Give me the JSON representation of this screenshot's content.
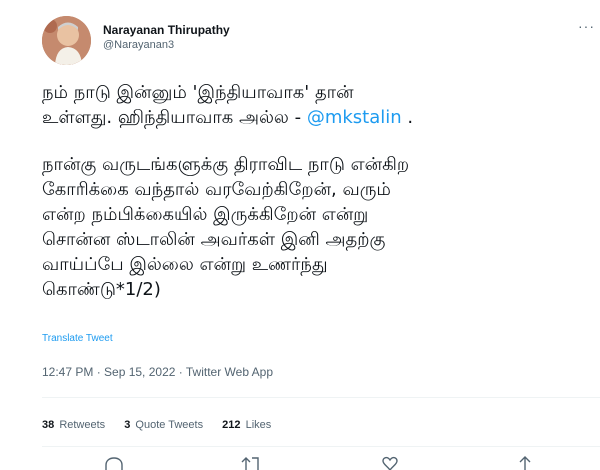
{
  "author": {
    "name": "Narayanan Thirupathy",
    "handle": "@Narayanan3"
  },
  "more_icon": "···",
  "tweet": {
    "line1": "நம் நாடு இன்னும் 'இந்தியாவாக' தான்",
    "line2_text": "உள்ளது. ஹிந்தியாவாக அல்ல - ",
    "mention": "@mkstalin",
    "line2_end": " .",
    "para2_lines": [
      "நான்கு வருடங்களுக்கு திராவிட நாடு என்கிற",
      "கோரிக்கை வந்தால் வரவேற்கிறேன், வரும்",
      "என்ற நம்பிக்கையில் இருக்கிறேன் என்று",
      "சொன்ன ஸ்டாலின் அவர்கள் இனி அதற்கு",
      "வாய்ப்பே இல்லை என்று உணர்ந்து",
      "கொண்டு*1/2)"
    ]
  },
  "translate_label": "Translate Tweet",
  "meta": "12:47 PM · Sep 15, 2022 · Twitter Web App",
  "stats": {
    "retweets_count": "38",
    "retweets_label": "Retweets",
    "quotes_count": "3",
    "quotes_label": "Quote Tweets",
    "likes_count": "212",
    "likes_label": "Likes"
  },
  "icons": [
    "reply-icon",
    "retweet-icon",
    "like-icon",
    "share-icon"
  ],
  "colors": {
    "accent": "#1d9bf0",
    "secondary": "#536471",
    "text": "#0f1419",
    "divider": "#eff3f4"
  }
}
